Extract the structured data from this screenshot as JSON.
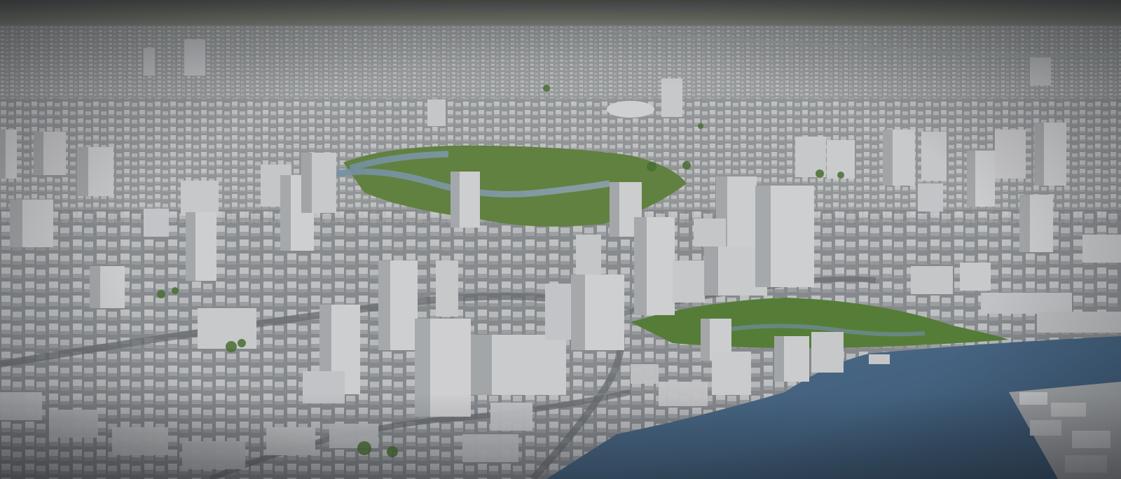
{
  "scene": {
    "subject": "3d-city-model-aerial",
    "colors": {
      "horizon": "#6f7368",
      "ground_far": "#8d918a",
      "building_light": "#e6e7e8",
      "building_mid": "#c9cbcd",
      "building_shadow": "#8f9397",
      "park_green": "#5f8a3a",
      "water": "#4a6f91",
      "road": "#6f7377"
    }
  }
}
